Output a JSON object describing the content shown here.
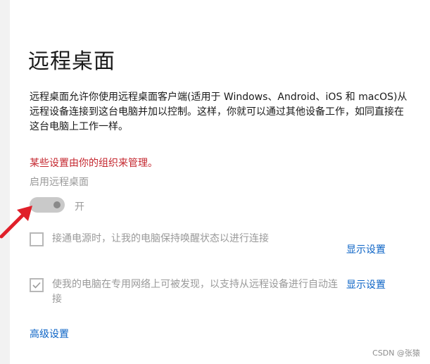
{
  "page": {
    "title": "远程桌面",
    "description": "远程桌面允许你使用远程桌面客户端(适用于 Windows、Android、iOS 和 macOS)从远程设备连接到这台电脑并加以控制。这样，你就可以通过其他设备工作，如同直接在这台电脑上工作一样。",
    "managed_warning": "某些设置由你的组织来管理。"
  },
  "remote_desktop_toggle": {
    "label": "启用远程桌面",
    "state": "开",
    "enabled": true
  },
  "options": [
    {
      "text": "接通电源时，让我的电脑保持唤醒状态以进行连接",
      "checked": false,
      "link": "显示设置"
    },
    {
      "text": "使我的电脑在专用网络上可被发现，以支持从远程设备进行自动连接",
      "checked": true,
      "link": "显示设置"
    }
  ],
  "advanced_link": "高级设置",
  "watermark": "CSDN @张猿",
  "colors": {
    "warning": "#c4262e",
    "link": "#0b63c6",
    "disabled_text": "#9a9a9a",
    "arrow": "#e0202a"
  },
  "icons": {
    "arrow": "red-arrow-icon",
    "check": "checkmark-icon"
  }
}
